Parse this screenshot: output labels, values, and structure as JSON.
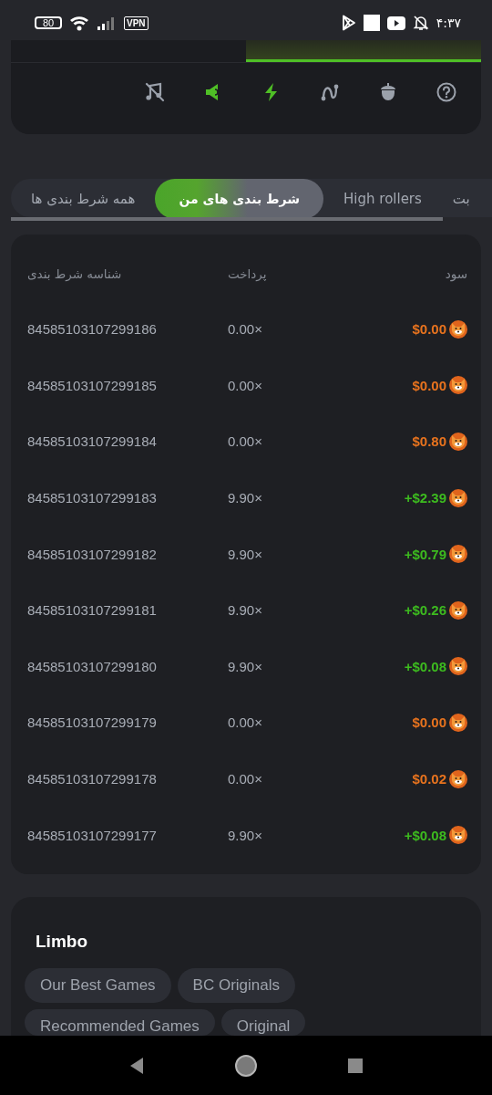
{
  "status_bar": {
    "battery": "80",
    "vpn": "VPN",
    "time": "۴:۳۷"
  },
  "toolbar": {
    "icons": [
      {
        "kind": "music-off",
        "active": false
      },
      {
        "kind": "horn",
        "active": true
      },
      {
        "kind": "bolt",
        "active": true
      },
      {
        "kind": "curve",
        "active": false
      },
      {
        "kind": "acorn",
        "active": false
      },
      {
        "kind": "help",
        "active": false
      }
    ]
  },
  "tabs": [
    {
      "label": "بت",
      "selected": false
    },
    {
      "label": "High rollers",
      "selected": false
    },
    {
      "label": "شرط بندی های من",
      "selected": true
    },
    {
      "label": "همه شرط بندی ها",
      "selected": false
    }
  ],
  "table": {
    "columns": [
      "سود",
      "پرداخت",
      "شناسه شرط بندی"
    ],
    "rows": [
      {
        "id": "84585103107299186",
        "payout": "0.00×",
        "profit": "$0.00",
        "color": "#e8731e"
      },
      {
        "id": "84585103107299185",
        "payout": "0.00×",
        "profit": "$0.00",
        "color": "#e8731e"
      },
      {
        "id": "84585103107299184",
        "payout": "0.00×",
        "profit": "$0.80",
        "color": "#e8731e"
      },
      {
        "id": "84585103107299183",
        "payout": "9.90×",
        "profit": "+$2.39",
        "color": "#3dbb1f"
      },
      {
        "id": "84585103107299182",
        "payout": "9.90×",
        "profit": "+$0.79",
        "color": "#3dbb1f"
      },
      {
        "id": "84585103107299181",
        "payout": "9.90×",
        "profit": "+$0.26",
        "color": "#3dbb1f"
      },
      {
        "id": "84585103107299180",
        "payout": "9.90×",
        "profit": "+$0.08",
        "color": "#3dbb1f"
      },
      {
        "id": "84585103107299179",
        "payout": "0.00×",
        "profit": "$0.00",
        "color": "#e8731e"
      },
      {
        "id": "84585103107299178",
        "payout": "0.00×",
        "profit": "$0.02",
        "color": "#e8731e"
      },
      {
        "id": "84585103107299177",
        "payout": "9.90×",
        "profit": "+$0.08",
        "color": "#3dbb1f"
      }
    ]
  },
  "game": {
    "title": "Limbo",
    "tags": [
      "Our Best Games",
      "BC Originals",
      "Recommended Games",
      "Original"
    ]
  }
}
